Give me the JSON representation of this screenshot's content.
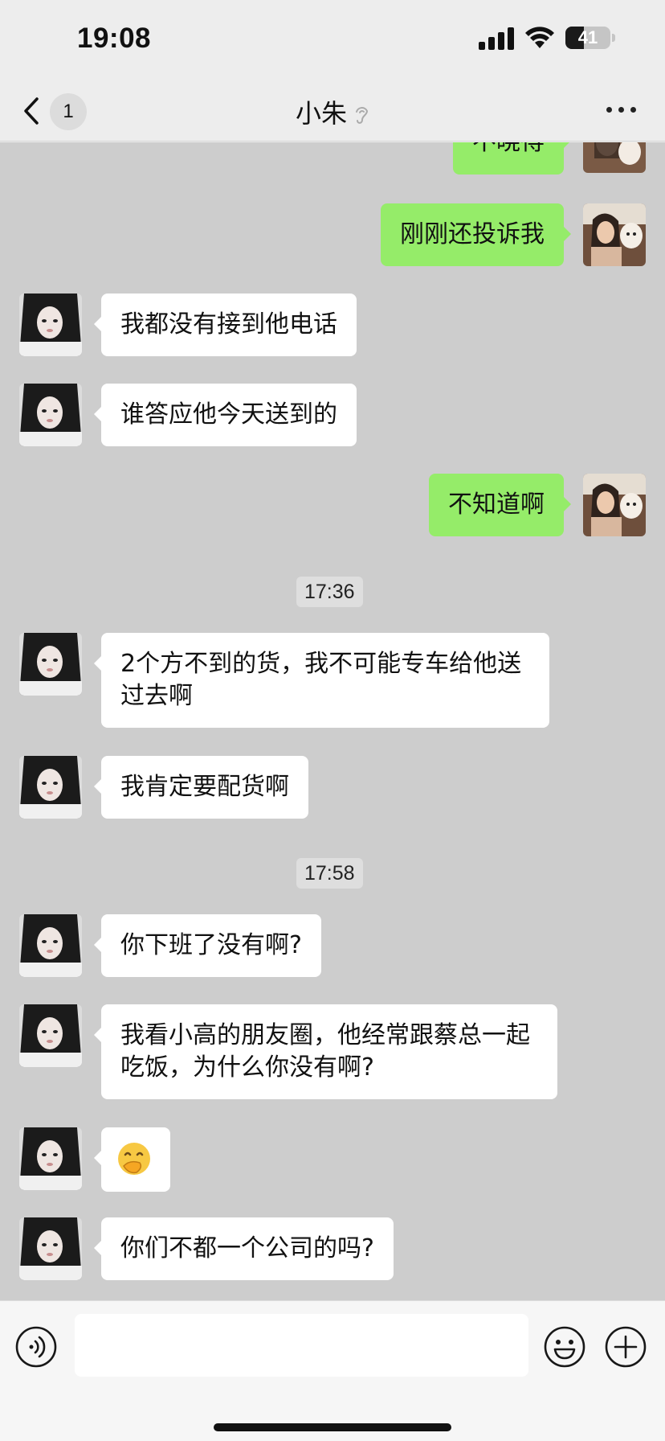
{
  "status_bar": {
    "time": "19:08",
    "battery_level": "41",
    "battery_fraction": 0.41
  },
  "header": {
    "unread_count": "1",
    "title": "小朱",
    "icons": [
      "chevron-left-icon",
      "ear-icon",
      "more-icon"
    ]
  },
  "messages": [
    {
      "type": "text",
      "side": "right",
      "text": "不晓得"
    },
    {
      "type": "text",
      "side": "right",
      "text": "刚刚还投诉我"
    },
    {
      "type": "text",
      "side": "left",
      "text": "我都没有接到他电话"
    },
    {
      "type": "text",
      "side": "left",
      "text": "谁答应他今天送到的"
    },
    {
      "type": "text",
      "side": "right",
      "text": "不知道啊"
    },
    {
      "type": "time",
      "text": "17:36"
    },
    {
      "type": "text",
      "side": "left",
      "text": "2个方不到的货，我不可能专车给他送过去啊"
    },
    {
      "type": "text",
      "side": "left",
      "text": "我肯定要配货啊"
    },
    {
      "type": "time",
      "text": "17:58"
    },
    {
      "type": "text",
      "side": "left",
      "text": "你下班了没有啊?"
    },
    {
      "type": "text",
      "side": "left",
      "text": "我看小高的朋友圈，他经常跟蔡总一起吃饭，为什么你没有啊?"
    },
    {
      "type": "emoji",
      "side": "left",
      "text": "🤭"
    },
    {
      "type": "text",
      "side": "left",
      "text": "你们不都一个公司的吗?"
    }
  ],
  "input": {
    "value": "",
    "placeholder": ""
  },
  "colors": {
    "sent_bubble": "#95ec69",
    "received_bubble": "#ffffff",
    "chat_background": "#cdcdcd"
  }
}
